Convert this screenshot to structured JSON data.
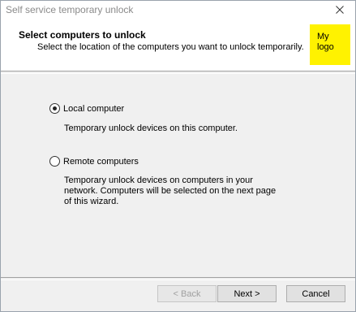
{
  "window": {
    "title": "Self service temporary unlock"
  },
  "header": {
    "title": "Select computers to unlock",
    "subtitle": "Select the location of the computers you want to unlock temporarily.",
    "logo_line1": "My",
    "logo_line2": "logo",
    "logo_color": "#fff200"
  },
  "options": [
    {
      "label": "Local computer",
      "selected": true,
      "description": [
        "Temporary unlock devices on this computer."
      ]
    },
    {
      "label": "Remote computers",
      "selected": false,
      "description": [
        "Temporary unlock devices on computers in your",
        "network. Computers will be selected on the next page",
        "of this wizard."
      ]
    }
  ],
  "buttons": {
    "back": "< Back",
    "next": "Next >",
    "cancel": "Cancel"
  },
  "icons": {
    "close": "close-icon",
    "radio_selected": "radio-selected-icon",
    "radio_empty": "radio-empty-icon"
  }
}
